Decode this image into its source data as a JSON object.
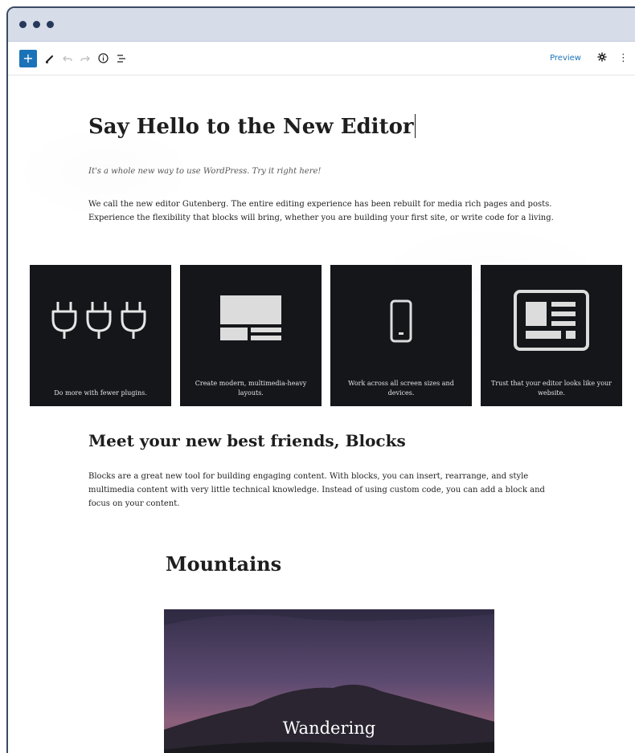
{
  "toolbar": {
    "add_label": "+",
    "preview_label": "Preview",
    "kebab_label": "⋮",
    "icons": [
      "add-icon",
      "pencil-icon",
      "undo-icon",
      "redo-icon",
      "info-icon",
      "list-view-icon",
      "gear-icon",
      "more-icon"
    ]
  },
  "post": {
    "title": "Say Hello to the New Editor",
    "intro_italic": "It's a whole new way to use WordPress. Try it right here!",
    "intro_paragraph": "We call the new editor Gutenberg. The entire editing experience has been rebuilt for media rich pages and posts. Experience the flexibility that blocks will bring, whether you are building your first site, or write code for a living."
  },
  "gallery": [
    {
      "caption": "Do more with fewer plugins.",
      "icon": "plugs-icon"
    },
    {
      "caption": "Create modern, multimedia-heavy layouts.",
      "icon": "layout-icon"
    },
    {
      "caption": "Work across all screen sizes and devices.",
      "icon": "phone-icon"
    },
    {
      "caption": "Trust that your editor looks like your website.",
      "icon": "website-icon"
    }
  ],
  "blocks_section": {
    "heading": "Meet your new best friends, Blocks",
    "paragraph": "Blocks are a great new tool for building engaging content. With blocks, you can insert, rearrange, and style multimedia content with very little technical knowledge. Instead of using custom code, you can add a block and focus on your content."
  },
  "mountains": {
    "heading": "Mountains",
    "cover_title": "Wandering"
  },
  "colors": {
    "accent": "#1a73b8",
    "titlebar": "#d6dce8",
    "frame_border": "#3b4a63",
    "tile_bg": "#14161a"
  }
}
